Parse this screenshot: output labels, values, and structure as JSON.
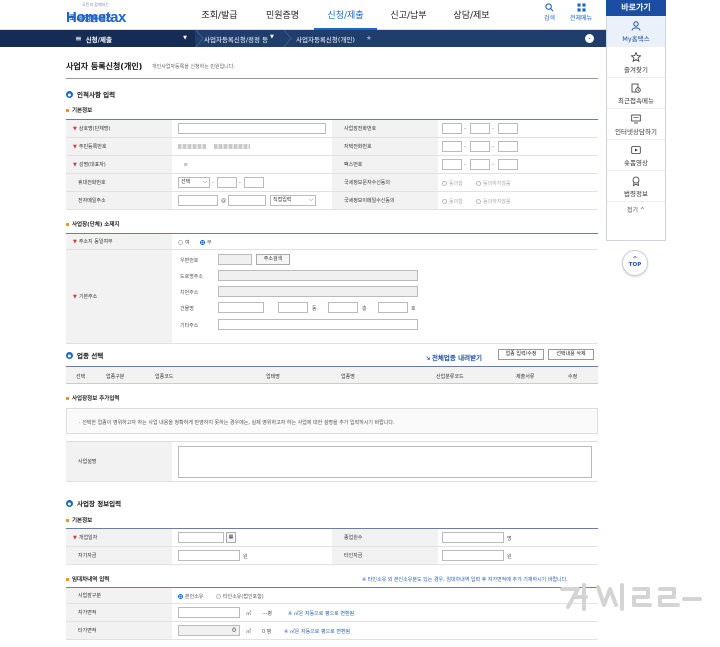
{
  "header": {
    "logo_tagline": "국민과 함께하는",
    "logo_brand": "Hometax",
    "logo_sub": "국세청홈택스",
    "nav": [
      "조회/발급",
      "민원증명",
      "신청/제출",
      "신고/납부",
      "상담/제보"
    ],
    "active_nav": "신청/제출",
    "search_label": "검색",
    "all_menu_label": "전체메뉴"
  },
  "quick": {
    "title": "바로가기",
    "items": [
      "My홈택스",
      "즐겨찾기",
      "최근접속메뉴",
      "인터넷상담하기",
      "숏폼영상",
      "법령정보"
    ],
    "fold_label": "접기 ^",
    "top_label": "TOP"
  },
  "location": {
    "home_label": "신청/제출",
    "crumb1": "사업자등록신청/정정 등",
    "crumb2": "사업자등록신청(개인)"
  },
  "page": {
    "title": "사업자 등록신청(개인)",
    "desc": "개인사업자등록을 신청하는 민원입니다."
  },
  "sec1": {
    "title": "인적사항 입력",
    "basic_title": "기본정보",
    "labels": {
      "trade_name": "상호명(단체명)",
      "rrn": "주민등록번호",
      "name": "성명(대표자)",
      "mobile": "휴대전화번호",
      "email": "전자메일주소",
      "biz_phone": "사업장전화번호",
      "home_phone": "자택전화번호",
      "fax": "팩스번호",
      "sms_consent": "국세정보문자수신동의",
      "email_consent": "국세정보이메일수신동의"
    },
    "select_default": "선택",
    "email_at": "@",
    "email_domain": "직접입력",
    "agree": "동의함",
    "disagree": "동의하지않음"
  },
  "addr": {
    "title": "사업장(단체) 소재지",
    "same_label": "주소지 동일여부",
    "yes": "여",
    "no": "부",
    "basic_addr": "기본주소",
    "zip": "우편번호",
    "zip_btn": "주소검색",
    "road": "도로명주소",
    "jibun": "지번주소",
    "building": "건물명",
    "dong": "동",
    "floor": "층",
    "ho": "호",
    "etc": "기타주소"
  },
  "industry": {
    "title": "업종 선택",
    "download_link": "전체업종 내려받기",
    "btn_edit": "업종 입력/수정",
    "btn_delete": "선택내용 삭제",
    "columns": [
      "선택",
      "업종구분",
      "업종코드",
      "업태명",
      "업종명",
      "산업분류코드",
      "제출서류",
      "수정"
    ],
    "extra_title": "사업장정보 추가입력",
    "extra_note": "선택한 업종이 영위하고자 하는 사업 내용을 정확하게 반영하지 못하는 경우에는, 실제 영위하고자 하는 사업에 대한 설명을 추가 입력하시기 바랍니다.",
    "desc_label": "사업설명"
  },
  "sec3": {
    "title": "사업장 정보입력",
    "basic_title": "기본정보",
    "open_date": "개업일자",
    "employees": "종업원수",
    "employees_unit": "명",
    "own_capital": "자기자금",
    "other_capital": "타인자금",
    "won": "원",
    "lease_title": "임대차내역 입력",
    "lease_note": "※ 타인소유 외 본인소유분도 있는 경우, 임대차내역 입력 후 자가면적에 추가 기재하시기 바랍니다.",
    "type_label": "사업장구분",
    "own": "본인소유",
    "other_own": "타인소유(법인포함)",
    "own_area": "자가면적",
    "other_area": "타가면적",
    "sqm": "㎡",
    "pyeong_dash": "---평",
    "pyeong_zero": "0 평",
    "other_area_value": "0",
    "convert_note": "※ ㎡은 자동으로 평으로 변환됨"
  }
}
